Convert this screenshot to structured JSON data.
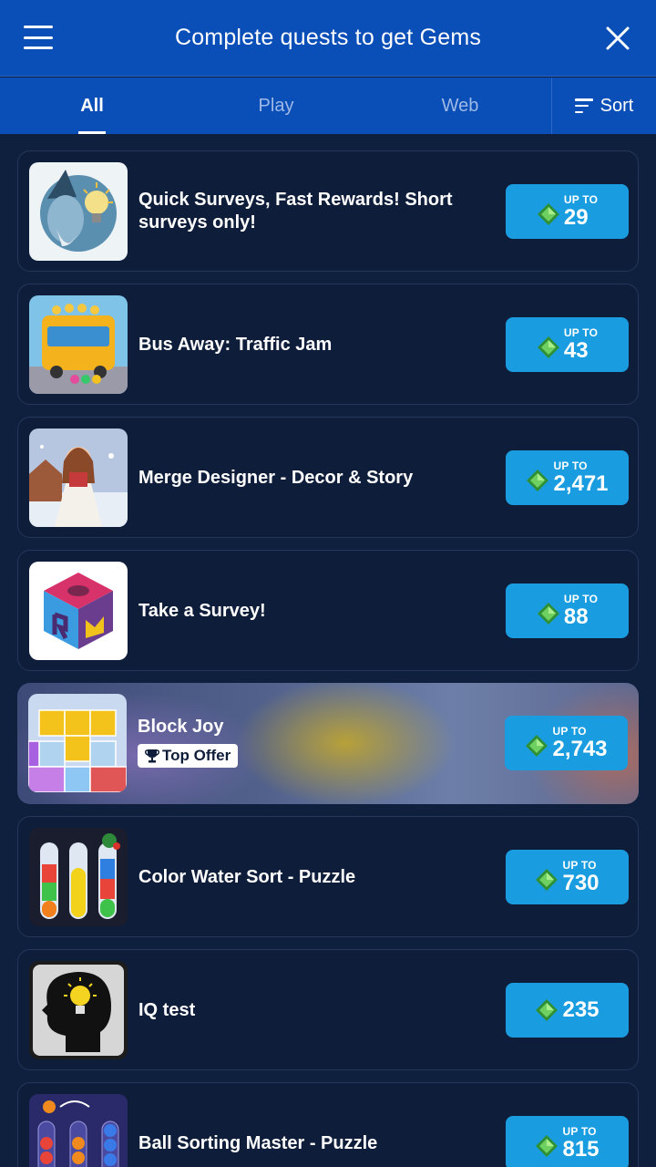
{
  "header": {
    "title": "Complete quests to get Gems"
  },
  "tabs": [
    {
      "label": "All",
      "active": true
    },
    {
      "label": "Play",
      "active": false
    },
    {
      "label": "Web",
      "active": false
    }
  ],
  "sort": {
    "label": "Sort"
  },
  "offers": [
    {
      "title": "Quick Surveys, Fast Rewards! Short surveys only!",
      "upto": "UP TO",
      "amount": "29",
      "thumb": "wizard-lightbulb"
    },
    {
      "title": "Bus Away: Traffic Jam",
      "upto": "UP TO",
      "amount": "43",
      "thumb": "yellow-bus"
    },
    {
      "title": "Merge Designer - Decor & Story",
      "upto": "UP TO",
      "amount": "2,471",
      "thumb": "woman-winter-house"
    },
    {
      "title": "Take a Survey!",
      "upto": "UP TO",
      "amount": "88",
      "thumb": "cube-logo"
    },
    {
      "title": "Block Joy",
      "badge": "Top Offer",
      "upto": "UP TO",
      "amount": "2,743",
      "thumb": "tetris-blocks",
      "featured": true
    },
    {
      "title": "Color Water Sort - Puzzle",
      "upto": "UP TO",
      "amount": "730",
      "thumb": "water-tubes"
    },
    {
      "title": "IQ test",
      "upto": "",
      "amount": "235",
      "thumb": "head-lightbulb"
    },
    {
      "title": "Ball Sorting Master - Puzzle",
      "upto": "UP TO",
      "amount": "815",
      "thumb": "ball-tubes"
    }
  ],
  "colors": {
    "header_bg": "#0a4fb8",
    "page_bg": "#0f1f3e",
    "card_bg": "#0e1d3a",
    "reward_bg": "#1a9de0",
    "gem_green": "#3fae3f"
  }
}
